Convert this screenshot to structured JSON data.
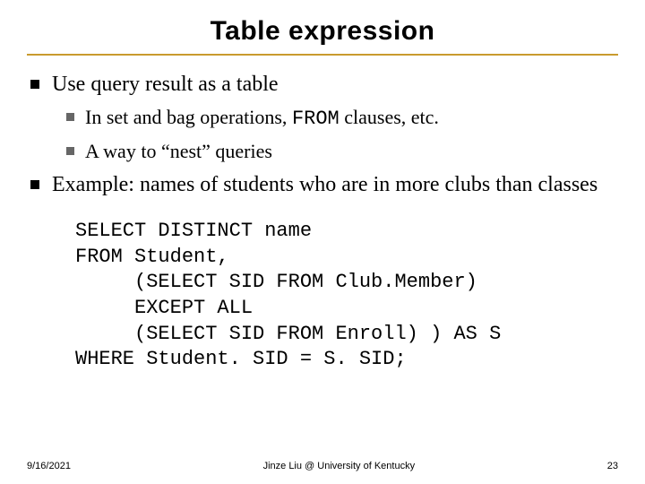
{
  "title": "Table expression",
  "bullets": {
    "b1": "Use query result as a table",
    "b1a_pre": "In set and bag operations, ",
    "b1a_code": "FROM",
    "b1a_post": " clauses, etc.",
    "b1b": "A way to “nest” queries",
    "b2": "Example: names of students who are in more clubs than classes"
  },
  "code": "SELECT DISTINCT name\nFROM Student,\n     (SELECT SID FROM Club.Member)\n     EXCEPT ALL\n     (SELECT SID FROM Enroll) ) AS S\nWHERE Student. SID = S. SID;",
  "footer": {
    "date": "9/16/2021",
    "center": "Jinze Liu @ University of Kentucky",
    "page": "23"
  }
}
